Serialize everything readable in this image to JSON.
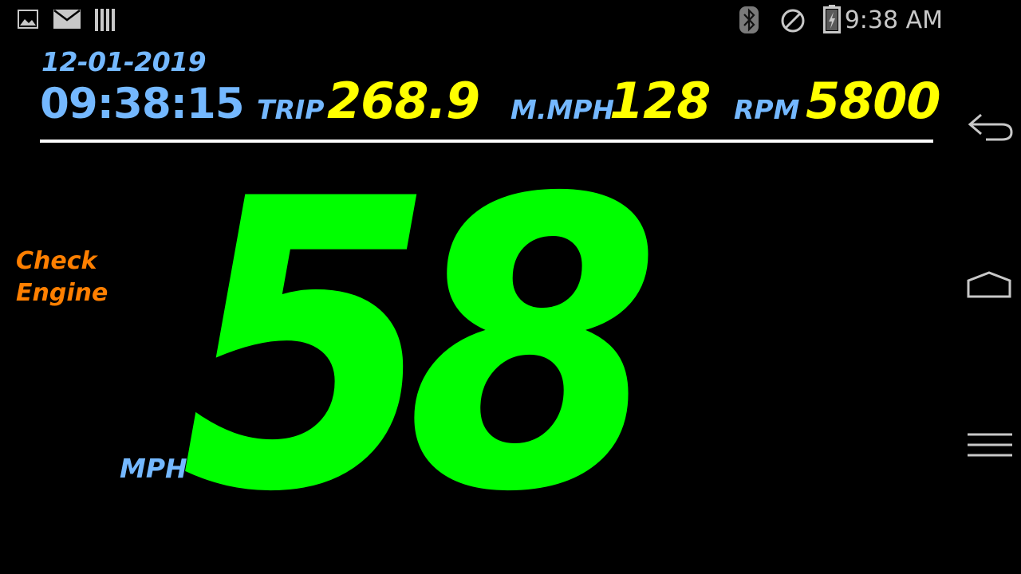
{
  "status_bar": {
    "time": "9:38 AM",
    "icons": [
      "image-icon",
      "mail-icon",
      "barcode-icon",
      "bluetooth-icon",
      "no-interruptions-icon",
      "battery-charging-icon"
    ]
  },
  "dashboard": {
    "date": "12-01-2019",
    "clock": "09:38:15",
    "trip_label": "TRIP",
    "trip_value": "268.9",
    "max_speed_label": "M.MPH",
    "max_speed_value": "128",
    "rpm_label": "RPM",
    "rpm_value": "5800",
    "warning_line1": "Check",
    "warning_line2": "Engine",
    "speed_value": "58",
    "speed_unit": "MPH"
  },
  "colors": {
    "background": "#000000",
    "label_blue": "#74b8ff",
    "value_yellow": "#ffff00",
    "speed_green": "#00ff00",
    "warning_orange": "#ff7f00",
    "divider_white": "#ffffff"
  },
  "nav_bar": {
    "buttons": [
      "back-icon",
      "home-icon",
      "menu-icon"
    ]
  }
}
